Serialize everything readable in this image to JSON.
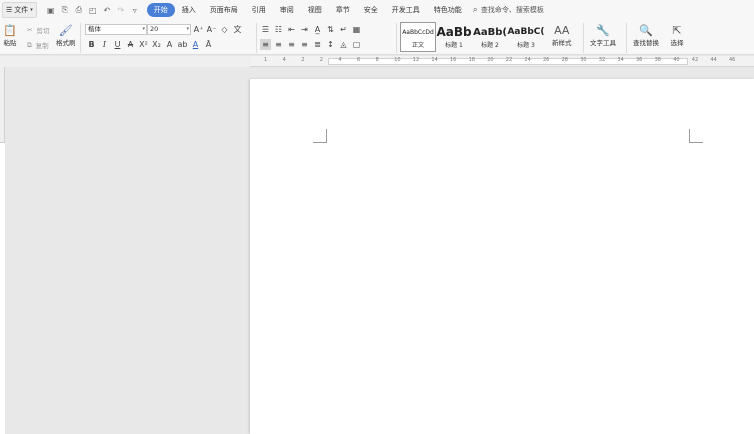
{
  "menubar": {
    "file_label": "文件",
    "tabs": [
      {
        "label": "开始",
        "active": true
      },
      {
        "label": "插入"
      },
      {
        "label": "页面布局"
      },
      {
        "label": "引用"
      },
      {
        "label": "审阅"
      },
      {
        "label": "视图"
      },
      {
        "label": "章节"
      },
      {
        "label": "安全"
      },
      {
        "label": "开发工具"
      },
      {
        "label": "特色功能"
      }
    ],
    "search_text": "查找命令、搜索模板"
  },
  "ribbon": {
    "paste": "粘贴",
    "cut": "剪切",
    "copy": "复制",
    "format_painter": "格式刷",
    "font_name": "楷体",
    "font_size": "20",
    "styles": [
      {
        "preview": "AaBbCcDd",
        "label": "正文"
      },
      {
        "preview": "AaBb",
        "label": "标题 1"
      },
      {
        "preview": "AaBb(",
        "label": "标题 2"
      },
      {
        "preview": "AaBbC(",
        "label": "标题 3"
      }
    ],
    "new_style": "新样式",
    "text_tools": "文字工具",
    "find_replace": "查找替换",
    "select": "选择"
  },
  "ruler": {
    "ticks": [
      "1",
      "4",
      "2",
      "2",
      "4",
      "6",
      "8",
      "10",
      "12",
      "14",
      "16",
      "18",
      "20",
      "22",
      "24",
      "26",
      "28",
      "30",
      "32",
      "34",
      "36",
      "38",
      "40",
      "42",
      "44",
      "46"
    ]
  },
  "colors": {
    "accent": "#4a7fd8",
    "page": "#ffffff",
    "background": "#e8e8e8"
  }
}
